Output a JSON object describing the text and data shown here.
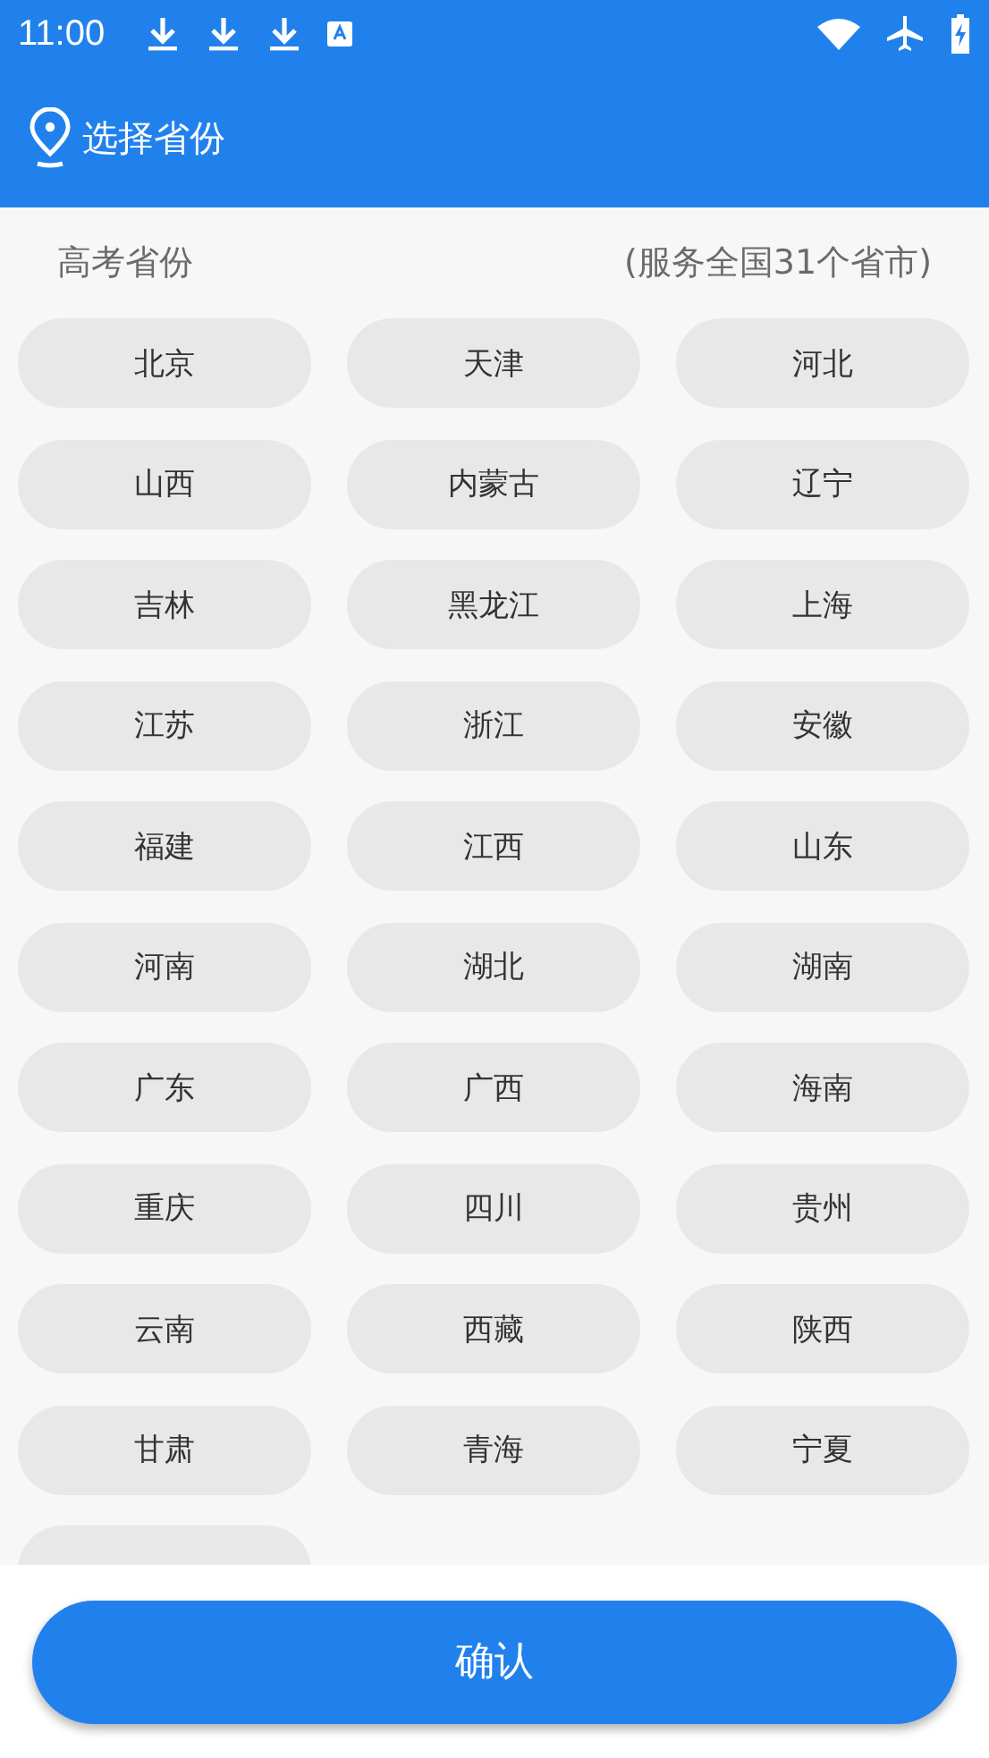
{
  "status_bar": {
    "time": "11:00"
  },
  "header": {
    "title": "选择省份"
  },
  "section": {
    "label": "高考省份",
    "note": "(服务全国31个省市)"
  },
  "provinces": [
    {
      "name": "北京",
      "selected": false
    },
    {
      "name": "天津",
      "selected": false
    },
    {
      "name": "河北",
      "selected": false
    },
    {
      "name": "山西",
      "selected": false
    },
    {
      "name": "内蒙古",
      "selected": false
    },
    {
      "name": "辽宁",
      "selected": false
    },
    {
      "name": "吉林",
      "selected": false
    },
    {
      "name": "黑龙江",
      "selected": false
    },
    {
      "name": "上海",
      "selected": false
    },
    {
      "name": "江苏",
      "selected": false
    },
    {
      "name": "浙江",
      "selected": false
    },
    {
      "name": "安徽",
      "selected": false
    },
    {
      "name": "福建",
      "selected": false
    },
    {
      "name": "江西",
      "selected": false
    },
    {
      "name": "山东",
      "selected": false
    },
    {
      "name": "河南",
      "selected": false
    },
    {
      "name": "湖北",
      "selected": false
    },
    {
      "name": "湖南",
      "selected": false
    },
    {
      "name": "广东",
      "selected": false
    },
    {
      "name": "广西",
      "selected": false
    },
    {
      "name": "海南",
      "selected": false
    },
    {
      "name": "重庆",
      "selected": false
    },
    {
      "name": "四川",
      "selected": false
    },
    {
      "name": "贵州",
      "selected": false
    },
    {
      "name": "云南",
      "selected": false
    },
    {
      "name": "西藏",
      "selected": false
    },
    {
      "name": "陕西",
      "selected": false
    },
    {
      "name": "甘肃",
      "selected": false
    },
    {
      "name": "青海",
      "selected": false
    },
    {
      "name": "宁夏",
      "selected": false
    },
    {
      "selected": false
    }
  ],
  "confirm_button": "确认"
}
